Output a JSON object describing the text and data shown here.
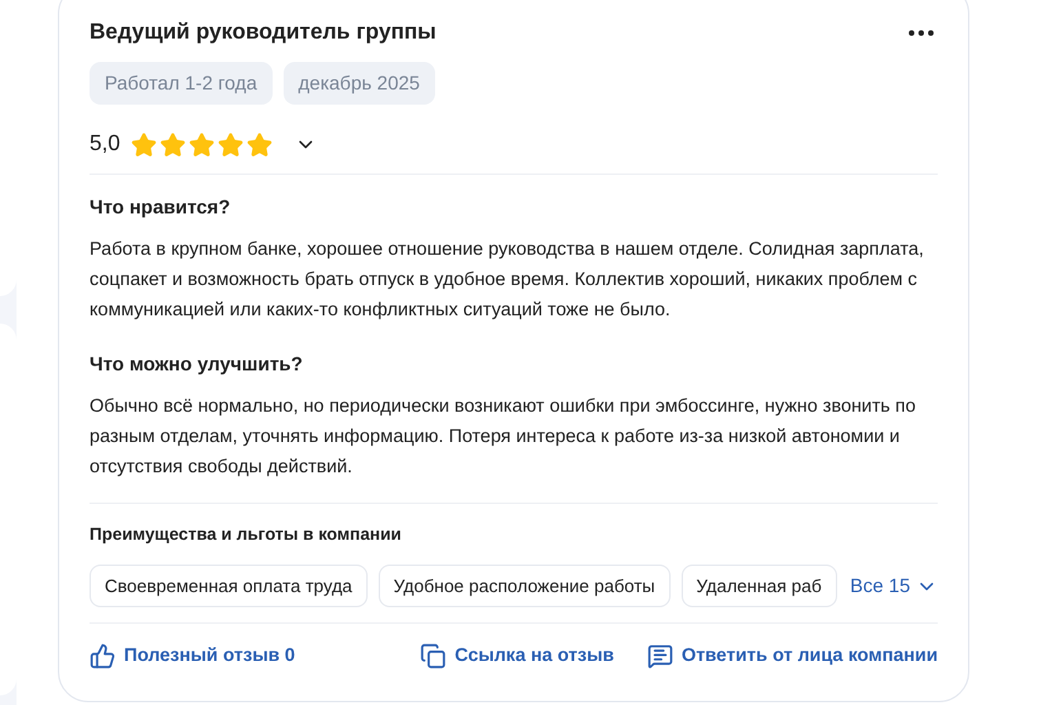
{
  "review": {
    "title": "Ведущий руководитель группы",
    "tags": [
      "Работал 1-2 года",
      "декабрь 2025"
    ],
    "rating": "5,0",
    "stars": 5,
    "sections": [
      {
        "heading": "Что нравится?",
        "text": "Работа в крупном банке, хорошее отношение руководства в нашем отделе. Солидная зарплата, соцпакет и возможность брать отпуск в удобное время. Коллектив хороший, никаких проблем с коммуникацией или каких-то конфликтных ситуаций тоже не было."
      },
      {
        "heading": "Что можно улучшить?",
        "text": "Обычно всё нормально, но периодически возникают ошибки при эмбоссинге, нужно звонить по разным отделам, уточнять информацию. Потеря интереса к работе из-за низкой автономии и отсутствия свободы действий."
      }
    ],
    "benefits": {
      "heading": "Преимущества и льготы в компании",
      "items": [
        "Своевременная оплата труда",
        "Удобное расположение работы",
        "Удаленная раб"
      ],
      "more": "Все 15"
    },
    "actions": [
      {
        "kind": "like",
        "label": "Полезный отзыв 0"
      },
      {
        "kind": "link",
        "label": "Ссылка на отзыв"
      },
      {
        "kind": "reply",
        "label": "Ответить от лица компании"
      }
    ]
  }
}
